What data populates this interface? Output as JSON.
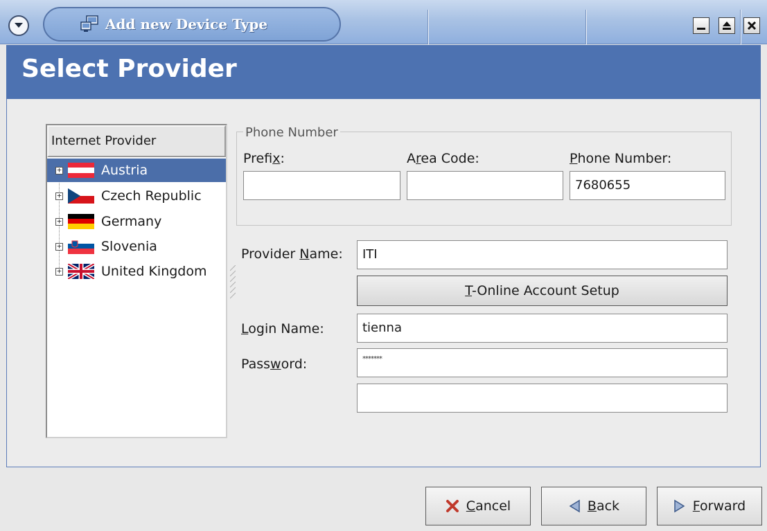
{
  "window": {
    "title": "Add new Device Type",
    "controls": [
      "minimize-icon",
      "maximize-icon",
      "close-icon"
    ]
  },
  "header": {
    "title": "Select Provider"
  },
  "provider_tree": {
    "column_header": "Internet Provider",
    "items": [
      {
        "label": "Austria",
        "flag": "austria-flag-icon",
        "selected": true
      },
      {
        "label": "Czech Republic",
        "flag": "czech-flag-icon",
        "selected": false
      },
      {
        "label": "Germany",
        "flag": "germany-flag-icon",
        "selected": false
      },
      {
        "label": "Slovenia",
        "flag": "slovenia-flag-icon",
        "selected": false
      },
      {
        "label": "United Kingdom",
        "flag": "uk-flag-icon",
        "selected": false
      }
    ]
  },
  "phone": {
    "group_label": "Phone Number",
    "prefix_label": "Prefix:",
    "prefix_value": "",
    "area_code_label": "Area Code:",
    "area_code_value": "",
    "phone_number_label": "Phone Number:",
    "phone_number_value": "7680655"
  },
  "provider": {
    "name_label": "Provider Name:",
    "name_value": "ITI",
    "t_online_button": "T-Online Account Setup",
    "login_label": "Login Name:",
    "login_value": "tienna",
    "password_label": "Password:",
    "password_value": "*******",
    "password_confirm_value": ""
  },
  "footer": {
    "cancel_label": "Cancel",
    "back_label": "Back",
    "forward_label": "Forward"
  },
  "colors": {
    "banner": "#4d72b1",
    "selection": "#4b6ea9",
    "titlebar": "#a9c2e4"
  }
}
